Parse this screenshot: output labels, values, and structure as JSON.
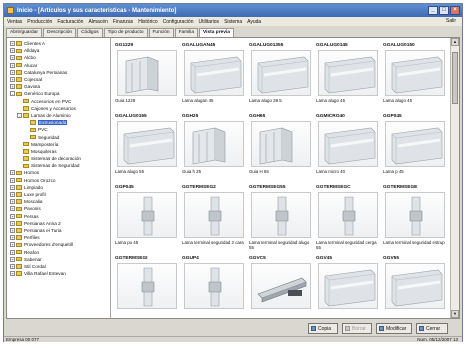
{
  "window": {
    "title": "Inicio - [Artículos y sus características - Mantenimiento]",
    "controls": {
      "minimize": "_",
      "maximize": "□",
      "close": "×"
    }
  },
  "menubar": {
    "items": [
      "Ventas",
      "Producción",
      "Facturación",
      "Almacén",
      "Finanzas",
      "Histórico",
      "Configuración",
      "Utilitarios",
      "Sistema",
      "Ayuda"
    ],
    "right_label": "Salir"
  },
  "tabs": [
    "Abrir/guardar",
    "Descripción",
    "Códigos",
    "Tipo de producto",
    "Función",
    "Familia",
    "Vista previa"
  ],
  "active_tab_index": 6,
  "tree": {
    "items": [
      {
        "label": "Clientes A",
        "expander": "+",
        "level": 0
      },
      {
        "label": "Alldaya",
        "expander": "+",
        "level": 0
      },
      {
        "label": "Alcbo",
        "expander": "+",
        "level": 0
      },
      {
        "label": "Alucar",
        "expander": "+",
        "level": 0
      },
      {
        "label": "Catalunya Persianas",
        "expander": "+",
        "level": 0
      },
      {
        "label": "Cojecsal",
        "expander": "+",
        "level": 0
      },
      {
        "label": "Gaviota",
        "expander": "+",
        "level": 0
      },
      {
        "label": "Genérico Europa",
        "expander": "-",
        "level": 0
      },
      {
        "label": "Accesorios en PVC",
        "expander": "",
        "level": 1
      },
      {
        "label": "Cajones y Accesorios",
        "expander": "",
        "level": 1
      },
      {
        "label": "Lamas de Aluminio",
        "expander": "-",
        "level": 1
      },
      {
        "label": "Extrusionada",
        "expander": "",
        "level": 2,
        "selected": true
      },
      {
        "label": "PVC",
        "expander": "",
        "level": 2
      },
      {
        "label": "Seguridad",
        "expander": "",
        "level": 2
      },
      {
        "label": "Mampostería",
        "expander": "",
        "level": 1
      },
      {
        "label": "Mosquiteras",
        "expander": "",
        "level": 1
      },
      {
        "label": "Sistemas de decoración",
        "expander": "",
        "level": 1
      },
      {
        "label": "Sistemas de Seguridad",
        "expander": "",
        "level": 1
      },
      {
        "label": "Hornos",
        "expander": "+",
        "level": 0
      },
      {
        "label": "Hornos Orozco",
        "expander": "+",
        "level": 0
      },
      {
        "label": "Limpiado",
        "expander": "+",
        "level": 0
      },
      {
        "label": "Luxe profil",
        "expander": "+",
        "level": 0
      },
      {
        "label": "Moscalia",
        "expander": "+",
        "level": 0
      },
      {
        "label": "Pavonis",
        "expander": "+",
        "level": 0
      },
      {
        "label": "Persas",
        "expander": "+",
        "level": 0
      },
      {
        "label": "Persianas Anna 2",
        "expander": "+",
        "level": 0
      },
      {
        "label": "Persianas el Turia",
        "expander": "+",
        "level": 0
      },
      {
        "label": "Perfiles",
        "expander": "+",
        "level": 0
      },
      {
        "label": "Proveedores d'enquetill",
        "expander": "+",
        "level": 0
      },
      {
        "label": "Reafon",
        "expander": "+",
        "level": 0
      },
      {
        "label": "Sabenar",
        "expander": "+",
        "level": 0
      },
      {
        "label": "Stil Cordal",
        "expander": "+",
        "level": 0
      },
      {
        "label": "Villa Rafael Estevan",
        "expander": "+",
        "level": 0
      }
    ]
  },
  "products": [
    {
      "code": "GG1229",
      "desc": "Guia 1229",
      "kind": "guide"
    },
    {
      "code": "GGALUGAN45",
      "desc": "Lama alugan 45",
      "kind": "slat"
    },
    {
      "code": "GGALUG01355",
      "desc": "Lama alugo 39.5",
      "kind": "slat"
    },
    {
      "code": "GGALUG0145",
      "desc": "Lama alugo 45",
      "kind": "slat"
    },
    {
      "code": "GGALUG0150",
      "desc": "Lama alugo 45",
      "kind": "slat"
    },
    {
      "code": "GGALUG0155",
      "desc": "Lama alugo 55",
      "kind": "slat"
    },
    {
      "code": "GGH25",
      "desc": "Guia h 25",
      "kind": "guide"
    },
    {
      "code": "GGH65",
      "desc": "Guia H 65",
      "kind": "guide"
    },
    {
      "code": "GGMICRO40",
      "desc": "Lama micro 40",
      "kind": "slat"
    },
    {
      "code": "GGP045",
      "desc": "Lama p 45",
      "kind": "slat"
    },
    {
      "code": "GGP045",
      "desc": "Lama po 45",
      "kind": "end"
    },
    {
      "code": "GGTERMSEG2",
      "desc": "Lama terminal seguridad 2 cara",
      "kind": "end"
    },
    {
      "code": "GGTERMSEG55",
      "desc": "Lama terminal seguridad alugo 55",
      "kind": "end"
    },
    {
      "code": "GGTERMSEGC",
      "desc": "Lama terminal seguridad cerga 55",
      "kind": "end"
    },
    {
      "code": "GGTERMSEGE",
      "desc": "Lama terminal seguridad estrup",
      "kind": "end"
    },
    {
      "code": "GGTERMSEGI",
      "desc": "",
      "kind": "end"
    },
    {
      "code": "GGUP4",
      "desc": "",
      "kind": "end"
    },
    {
      "code": "GGVC5",
      "desc": "",
      "kind": "profile"
    },
    {
      "code": "GGV45",
      "desc": "",
      "kind": "slat"
    },
    {
      "code": "GGV55",
      "desc": "",
      "kind": "slat"
    }
  ],
  "buttons": {
    "copy": "Copia",
    "delete": "Borrar",
    "modify": "Modificar",
    "close": "Cerrar"
  },
  "status": {
    "left": "Empresa 00  077",
    "right": "Num.  05/12/2007   13"
  }
}
